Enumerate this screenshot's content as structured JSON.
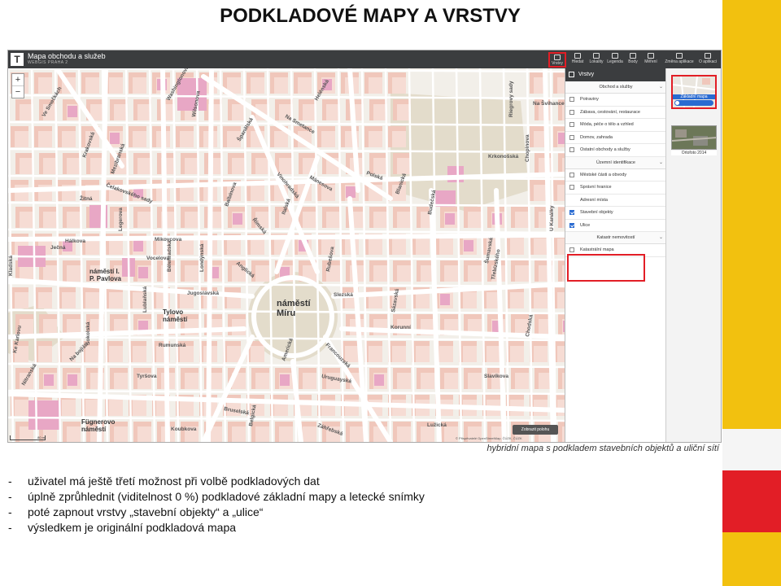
{
  "slide": {
    "title": "PODKLADOVÉ MAPY A VRSTVY",
    "caption": "hybridní mapa s podkladem stavebních objektů a uliční sítí",
    "bullets": [
      "uživatel má ještě třetí možnost při volbě podkladových dat",
      "úplně zprůhlednit  (viditelnost 0 %) podkladové základní mapy a letecké snímky",
      "poté zapnout vrstvy „stavební objekty“ a „ulice“",
      "výsledkem je originální podkladová mapa"
    ],
    "bullet_dash": "-"
  },
  "app": {
    "logo": "T",
    "title": "Mapa obchodu a služeb",
    "subtitle": "WEBGIS PRAHA 2",
    "toolbar": [
      {
        "label": "Vrstvy",
        "icon": "layers-icon",
        "active": true
      },
      {
        "label": "Hledat",
        "icon": "search-icon",
        "active": false
      },
      {
        "label": "Lokality",
        "icon": "location-icon",
        "active": false
      },
      {
        "label": "Legenda",
        "icon": "legend-icon",
        "active": false
      },
      {
        "label": "Body",
        "icon": "point-icon",
        "active": false
      },
      {
        "label": "Měření",
        "icon": "ruler-icon",
        "active": false
      },
      {
        "label": "Změna aplikace",
        "icon": "switch-app-icon",
        "active": false
      },
      {
        "label": "O aplikaci",
        "icon": "info-icon",
        "active": false
      }
    ],
    "zoom_in": "+",
    "zoom_out": "−",
    "show_photo": "Zobrazit polohu",
    "copyright": "© Přispěvatelé OpenStreetMap, ČÚZK, ČÚZK",
    "scale": "80 m",
    "colors": {
      "topbar": "#3b3d3f",
      "accent": "#2a6bd1",
      "highlight": "#e21e26"
    }
  },
  "panel": {
    "title": "Vrstvy",
    "sections": [
      {
        "header": "Obchod a služby",
        "items": [
          {
            "label": "Potraviny",
            "checked": false
          },
          {
            "label": "Zábava, cestování, restaurace",
            "checked": false
          },
          {
            "label": "Móda, péče o tělo a vzhled",
            "checked": false
          },
          {
            "label": "Domov, zahrada",
            "checked": false
          },
          {
            "label": "Ostatní obchody a služby",
            "checked": false
          }
        ]
      },
      {
        "header": "Územní identifikace",
        "items": [
          {
            "label": "Městské části a obvody",
            "checked": false
          },
          {
            "label": "Správní hranice",
            "checked": false
          },
          {
            "label": "Adresní místa",
            "checked": false,
            "nocheck": true
          },
          {
            "label": "Stavební objekty",
            "checked": true
          },
          {
            "label": "Ulice",
            "checked": true
          }
        ]
      },
      {
        "header": "Katastr nemovitostí",
        "items": [
          {
            "label": "Katastrální mapa",
            "checked": false
          }
        ]
      }
    ]
  },
  "basemaps": [
    {
      "label": "Základní mapa",
      "selected": true
    },
    {
      "label": "Ortofoto 2014",
      "selected": false
    }
  ],
  "map": {
    "squares": [
      "náměstí Míru",
      "Tylovo náměstí",
      "náměstí I. P. Pavlova",
      "Fügnerovo náměstí"
    ],
    "streets": [
      "Ve Smečkách",
      "Krakovská",
      "Mezibranská",
      "Čelakovského sady",
      "Legerova",
      "Žitná",
      "Jugoslávská",
      "Ječná",
      "Sokolská",
      "Lublaňská",
      "Bělehradská",
      "Londýnská",
      "Anglická",
      "Rumunská",
      "Tyršova",
      "Na bojišti",
      "Ke Karlovu",
      "Wilsonova",
      "Washingtonova",
      "Španělská",
      "Vinohradská",
      "Římská",
      "Italská",
      "Mánesova",
      "Polská",
      "Blanická",
      "Slezská",
      "Korunní",
      "Francouzská",
      "Americká",
      "Budečská",
      "Šumavská",
      "Chodská",
      "Uruguayská",
      "Lužická",
      "Bruselská",
      "Záhřebská",
      "Riegrovy sady",
      "Balbínova",
      "Vocelova",
      "Mikovcova",
      "Koubkova",
      "Hálkova",
      "Na Smetance",
      "Helénská",
      "Rubešova",
      "Chopinova",
      "Krkonošská",
      "Sázavská",
      "Belgická",
      "Slavíkova",
      "Třebízského",
      "U Kanálky",
      "Na Švihance",
      "Kladská",
      "Nitranská"
    ],
    "colors": {
      "street": "#ffffff",
      "block": "#f6dcd4",
      "building": "#f0c7bb",
      "pink": "#e8a7c5",
      "park": "#e3dccb",
      "bg": "#f2efe9"
    }
  }
}
